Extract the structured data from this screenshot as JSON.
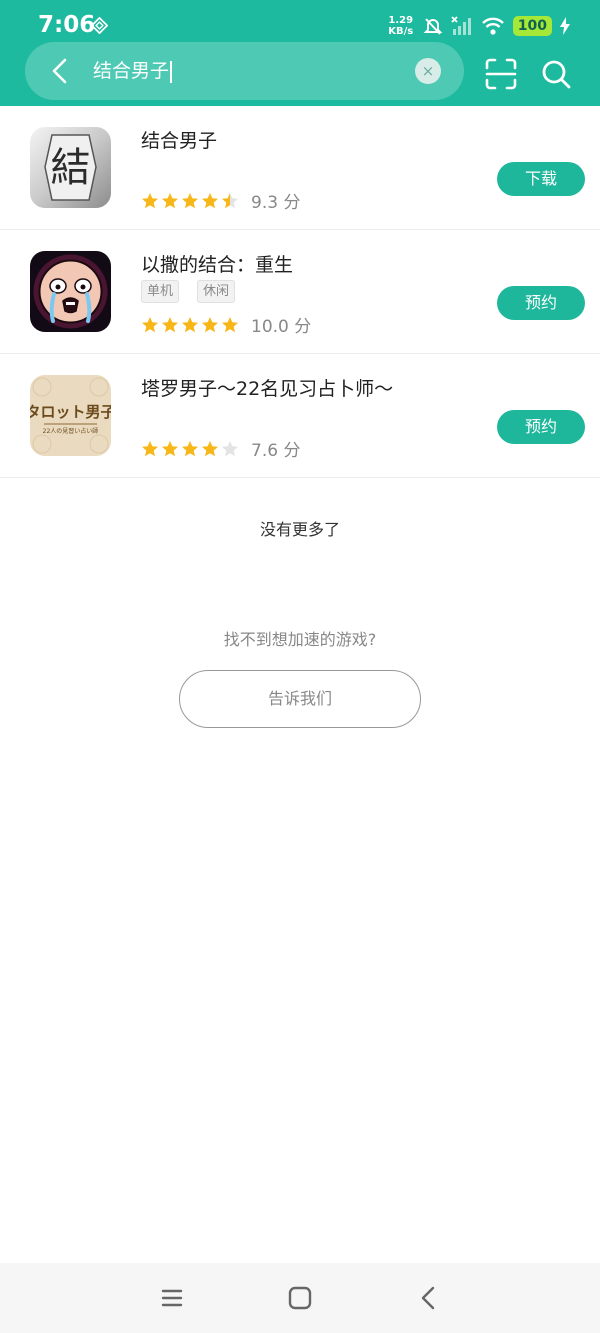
{
  "status_bar": {
    "time": "7:06",
    "net_speed_value": "1.29",
    "net_speed_unit": "KB/s",
    "battery": "100"
  },
  "search": {
    "query": "结合男子",
    "clear_glyph": "×"
  },
  "results": [
    {
      "name": "结合男子",
      "tags": [],
      "stars": 4.5,
      "score": "9.3 分",
      "action": "下载",
      "icon": "kanji-musubi-icon"
    },
    {
      "name": "以撒的结合：重生",
      "tags": [
        "单机",
        "休闲"
      ],
      "stars": 5,
      "score": "10.0 分",
      "action": "预约",
      "icon": "isaac-crying-face-icon"
    },
    {
      "name": "塔罗男子～22名见习占卜师～",
      "tags": [],
      "stars": 4,
      "score": "7.6 分",
      "action": "预约",
      "icon": "tarot-danshi-logo-icon"
    }
  ],
  "footer": {
    "no_more": "没有更多了",
    "not_found": "找不到想加速的游戏?",
    "tell_us": "告诉我们"
  },
  "colors": {
    "brand": "#1dba9f",
    "star": "#f7b719",
    "star_empty": "#e3e3e3"
  },
  "icons": {
    "back": "chevron-left-icon",
    "scan": "scan-icon",
    "search": "search-icon",
    "nav_menu": "menu-icon",
    "nav_home": "home-square-icon",
    "nav_back": "back-triangle-icon"
  }
}
